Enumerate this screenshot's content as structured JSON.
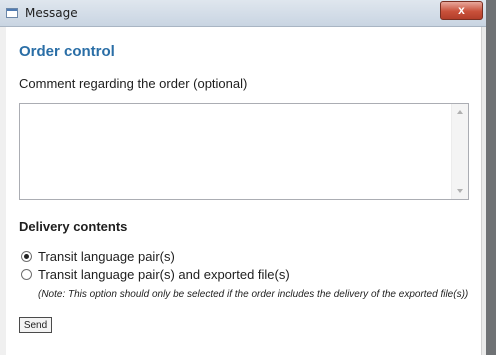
{
  "window": {
    "title": "Message",
    "close_glyph": "x"
  },
  "form": {
    "heading": "Order control",
    "comment_label": "Comment regarding the order (optional)",
    "comment_value": "",
    "delivery_heading": "Delivery contents",
    "options": [
      {
        "label": "Transit language pair(s)",
        "selected": true
      },
      {
        "label": "Transit language pair(s) and exported file(s)",
        "selected": false
      }
    ],
    "note": "(Note: This option should only be selected if the order includes the delivery of the exported file(s))",
    "send_label": "Send"
  },
  "colors": {
    "heading_blue": "#2a6ea6",
    "close_red": "#c9513b"
  }
}
